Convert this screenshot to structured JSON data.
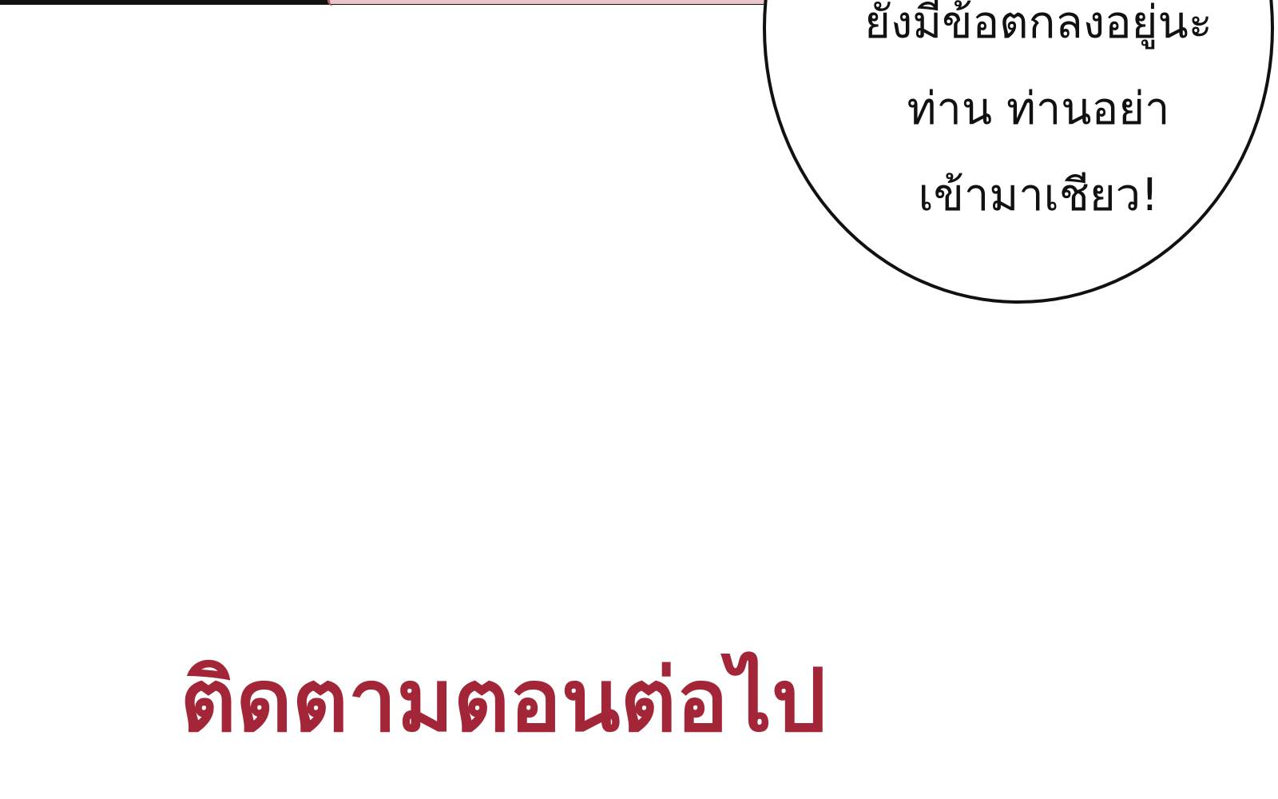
{
  "speech_bubble": {
    "lines": [
      "ยังมีข้อตกลงอยู่นะ",
      "ท่าน ท่านอย่า",
      "เข้ามาเชียว!"
    ]
  },
  "ending_banner": {
    "text": "ติดตามตอนต่อไป"
  },
  "colors": {
    "banner_text": "#a32638",
    "bubble_outline": "#111111",
    "background": "#ffffff"
  }
}
